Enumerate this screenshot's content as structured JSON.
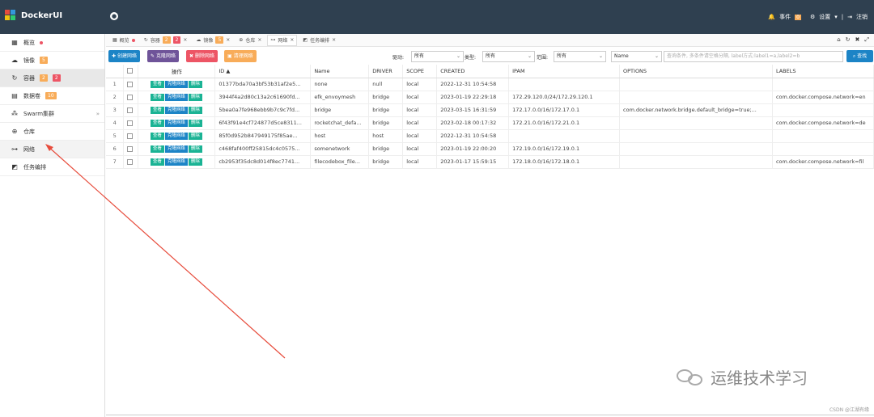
{
  "app": {
    "title": "DockerUI",
    "toggle_icon": "●",
    "events_label": "事件",
    "events_count": "0",
    "settings_label": "设置",
    "logout_label": "注销"
  },
  "sidebar": {
    "items": [
      {
        "icon": "grid-icon",
        "label": "概览",
        "dot": true
      },
      {
        "icon": "cloud-icon",
        "label": "镜像",
        "badge1": "5"
      },
      {
        "icon": "refresh-icon",
        "label": "容器",
        "badge1": "2",
        "badge2": "2"
      },
      {
        "icon": "storage-icon",
        "label": "数据卷",
        "badge1": "10"
      },
      {
        "icon": "sitemap-icon",
        "label": "Swarm集群"
      },
      {
        "icon": "globe-icon",
        "label": "仓库"
      },
      {
        "icon": "network-icon",
        "label": "网络"
      },
      {
        "icon": "tasks-icon",
        "label": "任务编排"
      }
    ]
  },
  "tabs": [
    {
      "label": "概览",
      "icon": "grid-icon",
      "dot": true
    },
    {
      "label": "容器",
      "icon": "refresh-icon",
      "badge1": "2",
      "badge2": "2"
    },
    {
      "label": "镜像",
      "icon": "cloud-icon",
      "badge1": "5"
    },
    {
      "label": "仓库",
      "icon": "globe-icon"
    },
    {
      "label": "网络",
      "icon": "network-icon"
    },
    {
      "label": "任务编排",
      "icon": "tasks-icon"
    }
  ],
  "toolbar": {
    "create_label": "创建网络",
    "prune_label": "克隆网络",
    "delete_label": "删除网络",
    "clean_label": "清理网络",
    "driver_label": "驱动:",
    "driver_value": "所有",
    "type_label": "类型:",
    "type_value": "所有",
    "scope_label": "范围:",
    "scope_value": "所有",
    "field_value": "Name",
    "search_placeholder": "查询条件, 多条件请空格分隔, label方式:label1=a,label2=b",
    "search_label": "查找"
  },
  "table": {
    "headers": [
      "",
      "",
      "操作",
      "ID ▲",
      "Name",
      "DRIVER",
      "SCOPE",
      "CREATED",
      "IPAM",
      "OPTIONS",
      "LABELS"
    ],
    "action_view": "查看",
    "action_clone": "克隆网络",
    "action_delete": "删除",
    "rows": [
      {
        "num": "1",
        "id": "01377bda70a3bf53b31af2e5...",
        "name": "none",
        "driver": "null",
        "scope": "local",
        "created": "2022-12-31 10:54:58",
        "ipam": "",
        "options": "",
        "labels": ""
      },
      {
        "num": "2",
        "id": "3944f4a2d80c13a2c61690fd...",
        "name": "efk_envoymesh",
        "driver": "bridge",
        "scope": "local",
        "created": "2023-01-19 22:29:18",
        "ipam": "172.29.120.0/24/172.29.120.1",
        "options": "",
        "labels": "com.docker.compose.network=en"
      },
      {
        "num": "3",
        "id": "5bea0a7fe968ebb9b7c9c7fd...",
        "name": "bridge",
        "driver": "bridge",
        "scope": "local",
        "created": "2023-03-15 16:31:59",
        "ipam": "172.17.0.0/16/172.17.0.1",
        "options": "com.docker.network.bridge.default_bridge=true;...",
        "labels": ""
      },
      {
        "num": "4",
        "id": "6f43f91e4cf724877d5ce8311...",
        "name": "rocketchat_defa...",
        "driver": "bridge",
        "scope": "local",
        "created": "2023-02-18 00:17:32",
        "ipam": "172.21.0.0/16/172.21.0.1",
        "options": "",
        "labels": "com.docker.compose.network=de"
      },
      {
        "num": "5",
        "id": "85f0d952b847949175f85ae...",
        "name": "host",
        "driver": "host",
        "scope": "local",
        "created": "2022-12-31 10:54:58",
        "ipam": "",
        "options": "",
        "labels": ""
      },
      {
        "num": "6",
        "id": "c468faf400ff25815dc4c0575...",
        "name": "somenetwork",
        "driver": "bridge",
        "scope": "local",
        "created": "2023-01-19 22:00:20",
        "ipam": "172.19.0.0/16/172.19.0.1",
        "options": "",
        "labels": ""
      },
      {
        "num": "7",
        "id": "cb2953f35dc8d014f8ec7741...",
        "name": "filecodebox_file...",
        "driver": "bridge",
        "scope": "local",
        "created": "2023-01-17 15:59:15",
        "ipam": "172.18.0.0/16/172.18.0.1",
        "options": "",
        "labels": "com.docker.compose.network=fil"
      }
    ]
  },
  "watermark": {
    "text": "运维技术学习",
    "csdn": "CSDN @江湖有缘"
  },
  "colors": {
    "topbar": "#2f4050",
    "primary": "#1c84c6",
    "success": "#1ab394",
    "danger": "#ed5565",
    "warning": "#f8ac59",
    "purple": "#6f5499",
    "arrow": "#e74c3c"
  }
}
